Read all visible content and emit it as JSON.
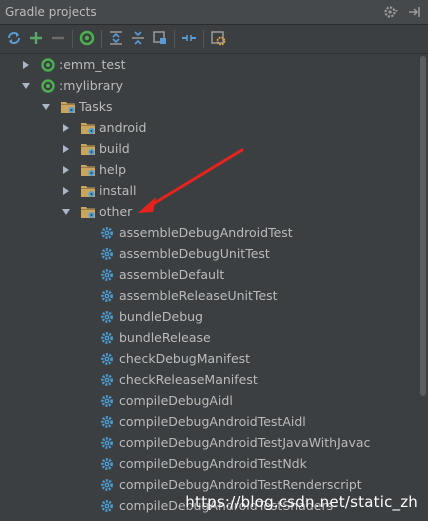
{
  "panel": {
    "title": "Gradle projects"
  },
  "toolbar": {
    "buttons": [
      {
        "name": "refresh-icon"
      },
      {
        "name": "add-icon"
      },
      {
        "name": "remove-icon"
      },
      {
        "name": "execute-gradle-task-icon"
      },
      {
        "name": "expand-all-icon"
      },
      {
        "name": "collapse-all-icon"
      },
      {
        "name": "attach-project-icon"
      },
      {
        "name": "toggle-offline-icon"
      },
      {
        "name": "gradle-settings-icon"
      }
    ]
  },
  "tree": {
    "projects": [
      {
        "label": ":emm_test",
        "expanded": false
      },
      {
        "label": ":mylibrary",
        "expanded": true
      }
    ],
    "tasks_label": "Tasks",
    "groups": [
      {
        "label": "android",
        "expanded": false
      },
      {
        "label": "build",
        "expanded": false
      },
      {
        "label": "help",
        "expanded": false
      },
      {
        "label": "install",
        "expanded": false
      },
      {
        "label": "other",
        "expanded": true
      }
    ],
    "tasks": [
      "assembleDebugAndroidTest",
      "assembleDebugUnitTest",
      "assembleDefault",
      "assembleReleaseUnitTest",
      "bundleDebug",
      "bundleRelease",
      "checkDebugManifest",
      "checkReleaseManifest",
      "compileDebugAidl",
      "compileDebugAndroidTestAidl",
      "compileDebugAndroidTestJavaWithJavac",
      "compileDebugAndroidTestNdk",
      "compileDebugAndroidTestRenderscript",
      "compileDebugAndroidTestShaders"
    ]
  },
  "watermark": "https://blog.csdn.net/static_zh",
  "colors": {
    "background": "#3c3f41",
    "text": "#bbbbbb",
    "gradle_green": "#4caf50",
    "folder": "#c9a55e",
    "gear": "#4a9fd8",
    "annotation_arrow": "#e8231d"
  }
}
